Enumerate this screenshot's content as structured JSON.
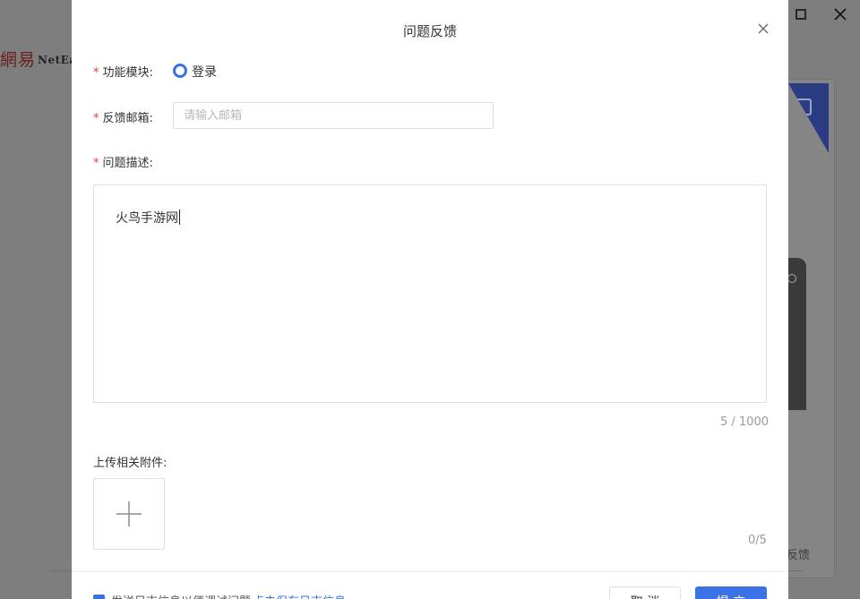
{
  "background": {
    "logo_cn": "網易",
    "logo_en": "NetEa",
    "side_label": "反馈"
  },
  "dialog": {
    "title": "问题反馈",
    "module": {
      "label": "功能模块:",
      "required_mark": "*",
      "option": "登录",
      "selected": true
    },
    "email": {
      "label": "反馈邮箱:",
      "required_mark": "*",
      "placeholder": "请输入邮箱",
      "value": ""
    },
    "description": {
      "label": "问题描述:",
      "required_mark": "*",
      "value": "火鸟手游网",
      "counter": "5 / 1000"
    },
    "attachments": {
      "label": "上传相关附件:",
      "counter": "0/5"
    },
    "footer": {
      "checkbox_label": "发送日志信息以便调试问题",
      "checkbox_checked": true,
      "link_text": "点击保存日志信息",
      "cancel_label": "取 消",
      "submit_label": "提 交"
    }
  },
  "colors": {
    "accent": "#3a71e5",
    "required": "#e53935",
    "overlay": "#7e7e7e"
  }
}
